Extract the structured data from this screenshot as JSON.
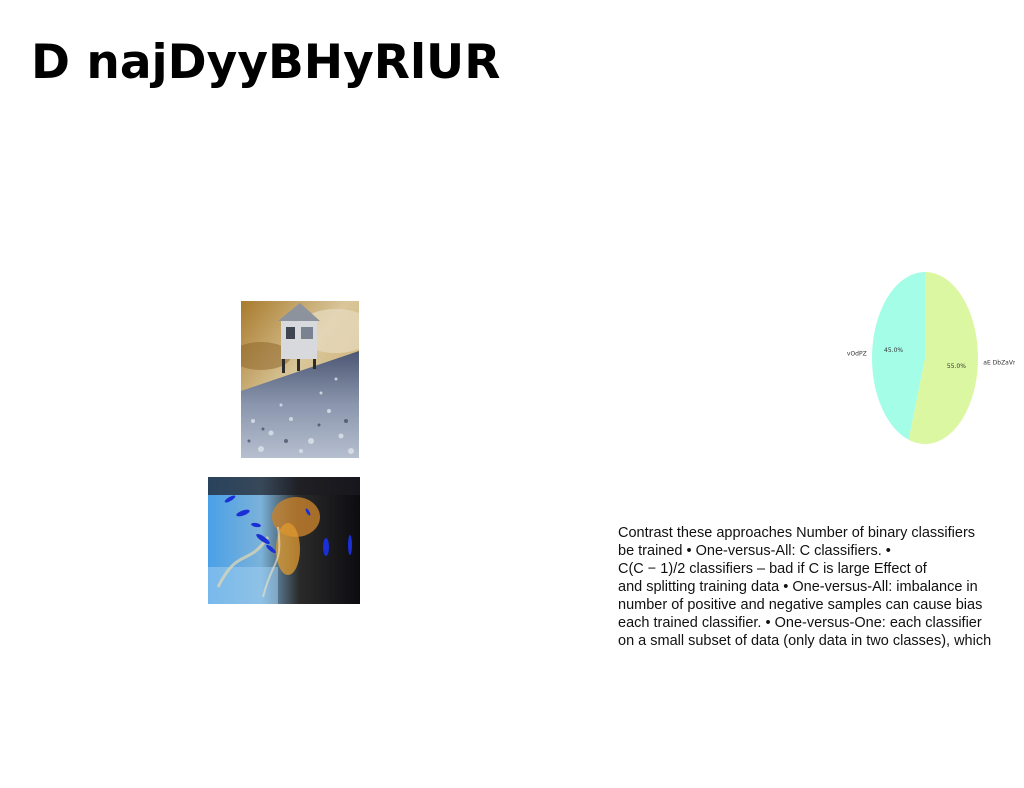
{
  "slide": {
    "title": "D najDyyBHyRlUR"
  },
  "images": {
    "hut": "hut-on-pebble-beach",
    "abstract": "abstract-blue-orange-painting"
  },
  "chart_data": {
    "type": "pie",
    "title": "",
    "slices": [
      {
        "label": "aE DbZaVn",
        "value": 55.0,
        "display": "55.0%",
        "color": "#dcf7a1"
      },
      {
        "label": "vOdPZ",
        "value": 45.0,
        "display": "45.0%",
        "color": "#a3fde7"
      }
    ]
  },
  "body": {
    "lines": [
      "Contrast these approaches Number of binary classifiers",
      "be trained • One-versus-All: C classifiers. •",
      "C(C − 1)/2 classifiers – bad if C is large Effect of",
      "and splitting training data • One-versus-All: imbalance in",
      "number of positive and negative samples can cause bias",
      "each trained classifier. • One-versus-One: each classifier",
      "on a small subset of data (only data in two classes), which"
    ]
  }
}
